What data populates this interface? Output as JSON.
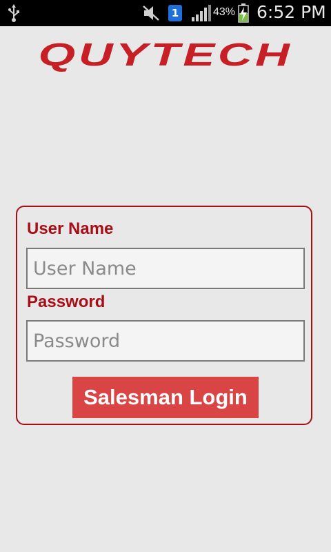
{
  "status_bar": {
    "battery_percent": "43%",
    "time": "6:52 PM",
    "notification_badge": "1",
    "icons": [
      "usb-icon",
      "mute-icon",
      "notification-icon",
      "signal-icon",
      "battery-charging-icon"
    ]
  },
  "brand": {
    "logo_text": "QUYTECH",
    "color": "#c62026"
  },
  "login_form": {
    "username_label": "User Name",
    "username_placeholder": "User Name",
    "username_value": "",
    "password_label": "Password",
    "password_placeholder": "Password",
    "password_value": "",
    "submit_label": "Salesman Login",
    "accent_color": "#a80e16",
    "button_color": "#d94545"
  }
}
